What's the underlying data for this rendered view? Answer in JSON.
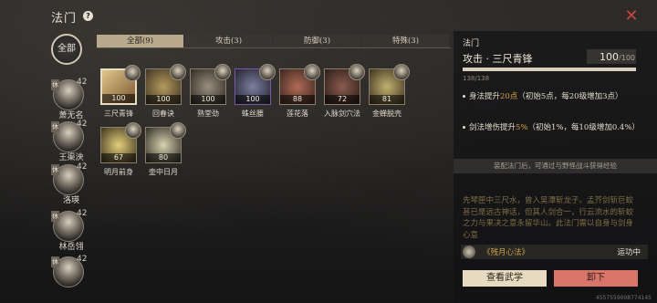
{
  "header": {
    "title": "法门",
    "help": "?",
    "close": "✕"
  },
  "sidebar": {
    "all_label": "全部",
    "characters": [
      {
        "name": "萧无名",
        "level": "42",
        "badge": "休"
      },
      {
        "name": "王渠泱",
        "level": "42",
        "badge": "休"
      },
      {
        "name": "洛瑛",
        "level": "42",
        "badge": "休"
      },
      {
        "name": "林岳翎",
        "level": "42",
        "badge": "休"
      },
      {
        "name": "",
        "level": "42",
        "badge": "休"
      }
    ]
  },
  "tabs": [
    {
      "label": "全部(9)",
      "active": true
    },
    {
      "label": "攻击(3)",
      "active": false
    },
    {
      "label": "防御(3)",
      "active": false
    },
    {
      "label": "特殊(3)",
      "active": false
    }
  ],
  "items": [
    {
      "name": "三尺青锋",
      "value": "100",
      "selected": true
    },
    {
      "name": "回春诀",
      "value": "100"
    },
    {
      "name": "熟堂劲",
      "value": "100"
    },
    {
      "name": "蛛丝腰",
      "value": "100",
      "purple": true
    },
    {
      "name": "莲花落",
      "value": "88"
    },
    {
      "name": "入脉剑穴法",
      "value": "72"
    },
    {
      "name": "金蝉脱壳",
      "value": "81"
    },
    {
      "name": "明月前身",
      "value": "67"
    },
    {
      "name": "壶中日月",
      "value": "80"
    }
  ],
  "detail": {
    "section": "法门",
    "skill_name": "攻击 · 三尺青锋",
    "score": "100",
    "score_max": "/100",
    "progress_text": "138/138",
    "progress_fraction": 1.0,
    "effect1_pre": "身法提升",
    "effect1_hi": "20点",
    "effect1_post": "（初始5点，每20级增加3点）",
    "effect2_pre": "剑法增伤提升",
    "effect2_hi": "5%",
    "effect2_post": "（初始1%，每10级增加0.4%）",
    "tip": "装配法门后，可通过与野怪战斗获得经验",
    "description": "先琴匣中三尺水，曾入吴潭斩龙子。孟芥剑斩巨蛟甚已是远古神话，但其人剑合一，行云流水的斩蛟之力与果决之意永留华山。此法门需以自身与剑身心意",
    "heart_name": "《残月心法》",
    "heart_status": "运功中",
    "btn_view": "查看武学",
    "btn_unequip": "卸下"
  },
  "uid": "4557559008774145",
  "colors": {
    "accent_red": "#c8463d",
    "gold": "#d6a342",
    "unequip": "#d8766c"
  }
}
